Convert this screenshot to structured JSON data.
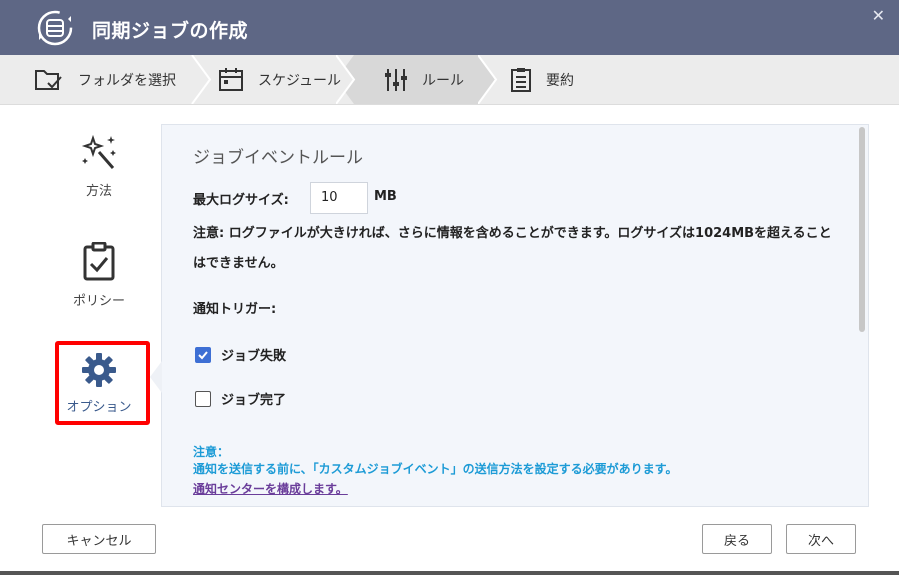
{
  "window": {
    "title": "同期ジョブの作成",
    "close_label": "✕"
  },
  "steps": [
    {
      "label": "フォルダを選択",
      "icon": "folder-check-icon"
    },
    {
      "label": "スケジュール",
      "icon": "calendar-icon"
    },
    {
      "label": "ルール",
      "icon": "sliders-icon"
    },
    {
      "label": "要約",
      "icon": "clipboard-list-icon"
    }
  ],
  "sidebar": {
    "items": [
      {
        "label": "方法",
        "icon": "magic-wand-icon"
      },
      {
        "label": "ポリシー",
        "icon": "clipboard-check-icon"
      },
      {
        "label": "オプション",
        "icon": "gear-icon"
      }
    ],
    "selected": "オプション"
  },
  "panel": {
    "section_title": "ジョブイベントルール",
    "max_log_size_label": "最大ログサイズ:",
    "max_log_size_value": "10",
    "max_log_size_unit": "MB",
    "note": "注意: ログファイルが大きければ、さらに情報を含めることができます。ログサイズは1024MBを超えることはできません。",
    "trigger_label": "通知トリガー:",
    "triggers": [
      {
        "label": "ジョブ失敗",
        "checked": true
      },
      {
        "label": "ジョブ完了",
        "checked": false
      }
    ],
    "notice_title": "注意：",
    "notice_text": "通知を送信する前に、「カスタムジョブイベント」の送信方法を設定する必要があります。",
    "notice_link": "通知センターを構成します。"
  },
  "buttons": {
    "cancel": "キャンセル",
    "back": "戻る",
    "next": "次へ"
  },
  "colors": {
    "titlebar": "#5e6785",
    "accent": "#3d6fd4",
    "highlight": "#ff0000",
    "notice": "#1d9bd6"
  }
}
